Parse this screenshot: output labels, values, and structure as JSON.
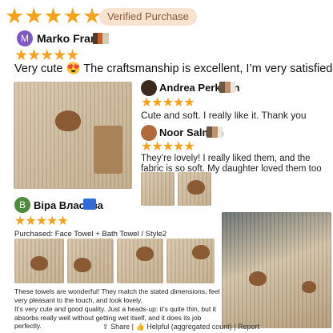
{
  "rating_banner": {
    "stars": "★★★★★",
    "badge": "Verified Purchase"
  },
  "review1": {
    "author": "Marko Frank",
    "initial": "M",
    "stars": "★★★★★",
    "text": "Very cute 😍 The craftsmanship is excellent, I’m very satisfied"
  },
  "review2": {
    "author": "Andrea Perkuhn",
    "stars": "★★★★★",
    "text": "Cute and soft. I really like it. Thank you"
  },
  "review3": {
    "author": "Noor Salman",
    "stars": "★★★★★",
    "text": "They’re lovely! I really liked them, and the fabric is so soft. My daughter loved them too"
  },
  "review4": {
    "author": "Віра Власова",
    "initial": "B",
    "stars": "★★★★★",
    "purchased": "Purchased: Face Towel + Bath Towel / Style2",
    "text1": "These towels are wonderful! They match the stated dimensions, feel very pleasant to the touch, and look lovely.",
    "text2": "It’s very cute and good quality. Just a heads-up: it’s quite thin, but it absorbs really well without getting wet itself, and it does its job perfectly."
  },
  "footer": {
    "share": "Share",
    "helpful": "Helpful (aggregated count)",
    "report": "Report",
    "sep": "|"
  },
  "colors": {
    "star": "#f7a21b",
    "badge_bg": "#f7e3cf",
    "avatar_m": "#7e57c2",
    "avatar_b": "#4b8b3b"
  }
}
